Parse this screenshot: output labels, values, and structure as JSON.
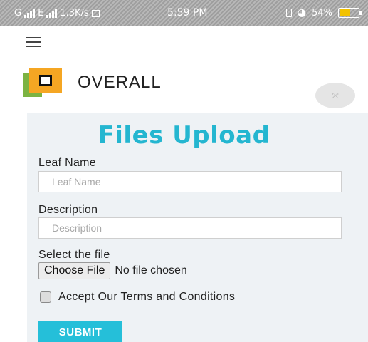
{
  "status_bar": {
    "carrier_left": "G",
    "carrier_mid": "E",
    "net_speed": "1.3K/s",
    "time": "5:59 PM",
    "battery": "54%",
    "battery_level": 0.54,
    "battery_color": "#f2c200"
  },
  "nav": {
    "menu_icon": "hamburger-icon"
  },
  "brand": {
    "name": "OVERALL",
    "logo_colors": [
      "#7cb342",
      "#f5a623",
      "#111111"
    ],
    "expand_icon": "expand-icon",
    "expand_glyph": "⤧"
  },
  "form": {
    "title": "Files Upload",
    "leaf_name_label": "Leaf Name",
    "leaf_name_placeholder": "Leaf Name",
    "description_label": "Description",
    "description_placeholder": "Description",
    "file_label": "Select the file",
    "choose_file_button": "Choose File",
    "file_status": "No file chosen",
    "terms_label": "Accept Our Terms and Conditions",
    "submit_label": "SUBMIT"
  },
  "colors": {
    "accent": "#24b6d0",
    "panel_bg": "#eef2f5"
  }
}
